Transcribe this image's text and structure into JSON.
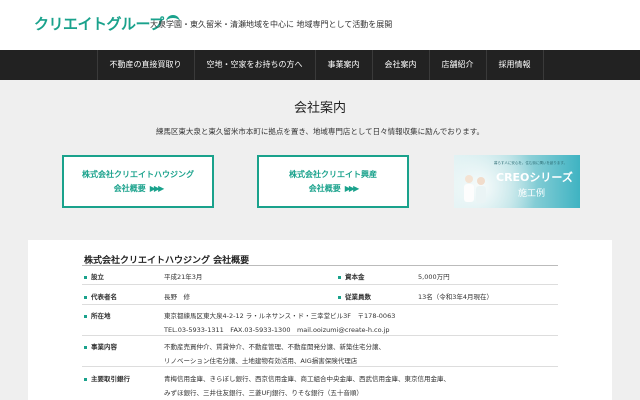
{
  "header": {
    "logo_text": "クリエイトグループ",
    "tagline": "大泉学園・東久留米・清瀬地域を中心に 地域専門として活動を展開"
  },
  "nav": {
    "items": [
      {
        "label": "不動産の直接買取り"
      },
      {
        "label": "空地・空家をお持ちの方へ"
      },
      {
        "label": "事業案内"
      },
      {
        "label": "会社案内"
      },
      {
        "label": "店舗紹介"
      },
      {
        "label": "採用情報"
      }
    ]
  },
  "main": {
    "title": "会社案内",
    "lead": "練馬区東大泉と東久留米市本町に拠点を置き、地域専門店として日々情報収集に励んでおります。"
  },
  "cards": [
    {
      "title": "株式会社クリエイトハウジング",
      "sub": "会社概要",
      "arrows": "▶▶▶"
    },
    {
      "title": "株式会社クリエイト興産",
      "sub": "会社概要",
      "arrows": "▶▶▶"
    }
  ],
  "banner": {
    "copy": "暮らす人に安心を。住む街に潤いを創ります。",
    "title": "CREOシリーズ",
    "sub": "施工例"
  },
  "profile": {
    "title": "株式会社クリエイトハウジング 会社概要",
    "rows": {
      "founded": {
        "label": "設立",
        "value": "平成21年3月"
      },
      "capital": {
        "label": "資本金",
        "value": "5,000万円"
      },
      "ceo": {
        "label": "代表者名",
        "value": "長野　修"
      },
      "staff": {
        "label": "従業員数",
        "value": "13名（令和3年4月現在）"
      },
      "address": {
        "label": "所在地",
        "value": "東京都練馬区東大泉4-2-12 ラ・ルネサンス・ド・三幸堂ビル3F　〒178-0063",
        "value2": "TEL.03-5933-1311　FAX.03-5933-1300　mail.ooizumi@create-h.co.jp"
      },
      "business": {
        "label": "事業内容",
        "value": "不動産売買仲介、賃貸仲介、不動産管理、不動産開発分譲、新築住宅分譲、",
        "value2": "リノベーション住宅分譲、土地建物有効活用、AIG損害保険代理店"
      },
      "banks": {
        "label": "主要取引銀行",
        "value": "青梅信用金庫、きらぼし銀行、西京信用金庫、商工組合中央金庫、西武信用金庫、東京信用金庫、",
        "value2": "みずほ銀行、三井住友銀行、三菱UFJ銀行、りそな銀行（五十音順）"
      }
    }
  },
  "colors": {
    "accent": "#1aa28c",
    "nav_bg": "#222222",
    "page_bg": "#efefef"
  }
}
